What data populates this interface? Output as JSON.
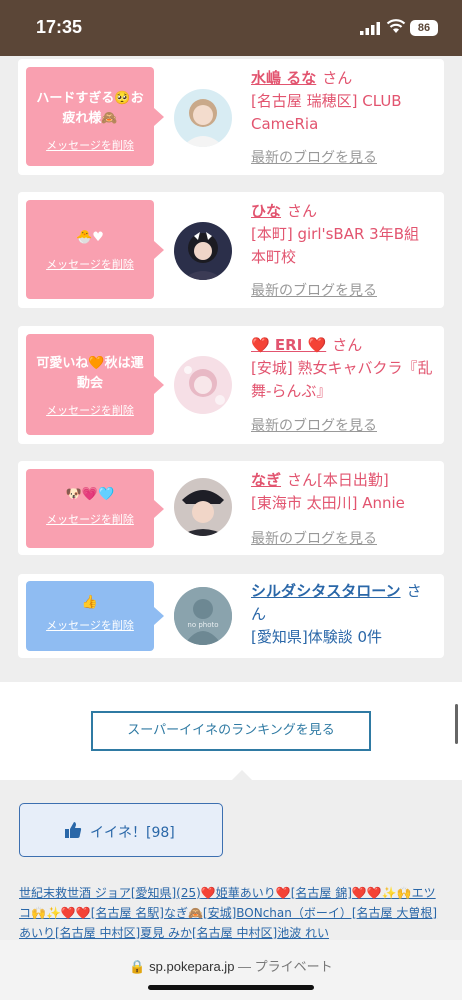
{
  "status": {
    "time": "17:35",
    "battery": "86"
  },
  "cards": [
    {
      "bubble_text": "ハードすぎる🥺お疲れ様🙈",
      "delete": "メッセージを削除",
      "name": "水嶋 るな",
      "san": "さん",
      "shop": "[名古屋 瑞穂区] CLUB CameRia",
      "blog": "最新のブログを見る"
    },
    {
      "bubble_text": "🐣♥",
      "delete": "メッセージを削除",
      "name": "ひな",
      "san": "さん",
      "shop": "[本町] girl'sBAR 3年B組 本町校",
      "blog": "最新のブログを見る"
    },
    {
      "bubble_text": "可愛いね🧡秋は運動会",
      "delete": "メッセージを削除",
      "name": "❤️ ERI ❤️",
      "san": "さん",
      "shop": "[安城] 熟女キャバクラ『乱舞-らんぶ』",
      "blog": "最新のブログを見る"
    },
    {
      "bubble_text": "🐶💗🩵",
      "delete": "メッセージを削除",
      "name": "なぎ",
      "san": "さん[本日出勤]",
      "shop": "[東海市 太田川] Annie",
      "blog": "最新のブログを見る"
    },
    {
      "bubble_text": "👍",
      "delete": "メッセージを削除",
      "name": "シルダシタスタローン",
      "san": "さん",
      "shop": "[愛知県]体験談 0件",
      "avatar_label": "no photo"
    }
  ],
  "ranking_button": "スーパーイイネのランキングを見る",
  "like_button": "イイネ！[98]",
  "likers": [
    "世紀末救世酒 ジョア[愛知県](25)",
    "❤️姫華あいり❤️[名古屋 錦]",
    "❤️❤️✨🙌エツコ🙌✨❤️❤️[名古屋 名駅]",
    "なぎ🙈[安城]",
    "BONchan（ボーイ）[名古屋 大曽根]",
    "あいり[名古屋 中村区]",
    "夏見 みか[名古屋 中村区]",
    "池波 れい"
  ],
  "url": {
    "domain": "sp.pokepara.jp",
    "suffix": "— プライベート"
  }
}
